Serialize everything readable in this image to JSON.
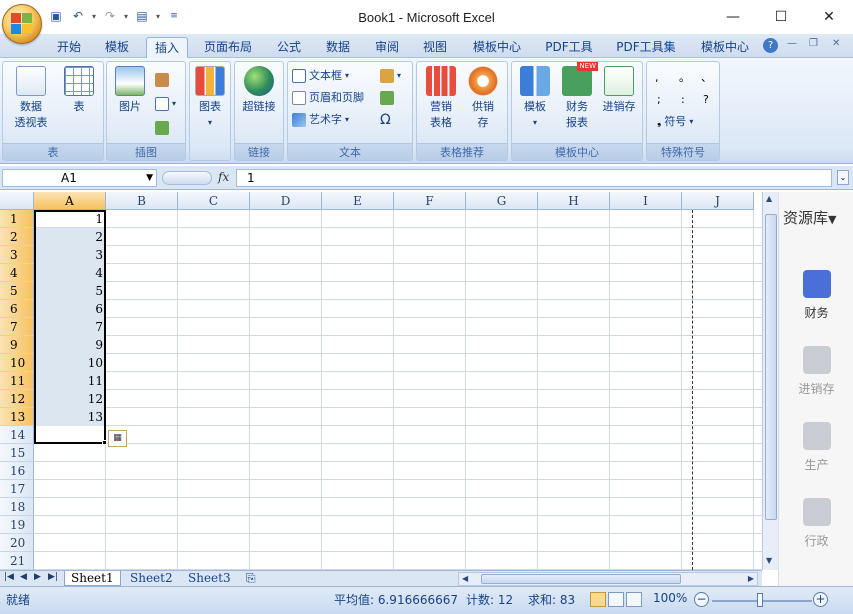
{
  "window": {
    "title": "Book1 - Microsoft Excel",
    "controls": [
      "minimize",
      "maximize",
      "close"
    ]
  },
  "quick_access": [
    "save-icon",
    "undo-icon",
    "redo-icon",
    "print-preview-icon",
    "customize-icon"
  ],
  "tabs": [
    {
      "label": "开始"
    },
    {
      "label": "模板"
    },
    {
      "label": "插入",
      "active": true
    },
    {
      "label": "页面布局"
    },
    {
      "label": "公式"
    },
    {
      "label": "数据"
    },
    {
      "label": "审阅"
    },
    {
      "label": "视图"
    },
    {
      "label": "模板中心"
    },
    {
      "label": "PDF工具"
    },
    {
      "label": "PDF工具集"
    },
    {
      "label": "模板中心"
    }
  ],
  "ribbon": {
    "groups": [
      {
        "label": "表",
        "buttons": [
          "数据\n透视表",
          "表"
        ]
      },
      {
        "label": "插图",
        "buttons": [
          "图片"
        ]
      },
      {
        "label": "",
        "buttons": [
          "图表"
        ]
      },
      {
        "label": "链接",
        "buttons": [
          "超链接"
        ]
      },
      {
        "label": "文本",
        "buttons": [
          "文本框",
          "页眉和页脚",
          "艺术字"
        ]
      },
      {
        "label": "表格推荐",
        "buttons": [
          "营销\n表格",
          "供销\n存"
        ]
      },
      {
        "label": "模板中心",
        "buttons": [
          "模板",
          "财务\n报表",
          "进销存"
        ]
      },
      {
        "label": "特殊符号",
        "buttons": [
          "符号"
        ]
      }
    ],
    "pivot_line1": "数据",
    "pivot_line2": "透视表",
    "table": "表",
    "picture": "图片",
    "chart": "图表",
    "hyperlink": "超链接",
    "textbox": "文本框",
    "header_footer": "页眉和页脚",
    "wordart": "艺术字",
    "omega": "Ω",
    "marketing_1": "营销",
    "marketing_2": "表格",
    "supply_1": "供销",
    "supply_2": "存",
    "template": "模板",
    "finance_1": "财务",
    "finance_2": "报表",
    "inventory": "进销存",
    "new_badge": "NEW",
    "symbol": "符号",
    "sym_chars": [
      ",",
      "。",
      "、",
      ";",
      ":",
      "?"
    ]
  },
  "formula_bar": {
    "name_box": "A1",
    "fx": "fx",
    "value": "1"
  },
  "columns": [
    "A",
    "B",
    "C",
    "D",
    "E",
    "F",
    "G",
    "H",
    "I",
    "J"
  ],
  "rows": [
    {
      "n": "1",
      "a": "1"
    },
    {
      "n": "2",
      "a": "2"
    },
    {
      "n": "3",
      "a": "3"
    },
    {
      "n": "4",
      "a": "4"
    },
    {
      "n": "5",
      "a": "5"
    },
    {
      "n": "6",
      "a": "6"
    },
    {
      "n": "7",
      "a": "7"
    },
    {
      "n": "9",
      "a": "9"
    },
    {
      "n": "10",
      "a": "10"
    },
    {
      "n": "11",
      "a": "11"
    },
    {
      "n": "12",
      "a": "12"
    },
    {
      "n": "13",
      "a": "13"
    },
    {
      "n": "14",
      "a": ""
    },
    {
      "n": "15",
      "a": ""
    },
    {
      "n": "16",
      "a": ""
    },
    {
      "n": "17",
      "a": ""
    },
    {
      "n": "18",
      "a": ""
    },
    {
      "n": "19",
      "a": ""
    },
    {
      "n": "20",
      "a": ""
    },
    {
      "n": "21",
      "a": ""
    }
  ],
  "selected_rows": 12,
  "sheets": [
    {
      "label": "Sheet1",
      "active": true
    },
    {
      "label": "Sheet2"
    },
    {
      "label": "Sheet3"
    }
  ],
  "side_panel": {
    "title": "资源库",
    "items": [
      {
        "label": "财务",
        "icon": "wallet-icon",
        "color": "#4a6fd8"
      },
      {
        "label": "进销存",
        "icon": "swap-icon",
        "color": "#c9ccd2"
      },
      {
        "label": "生产",
        "icon": "import-icon",
        "color": "#c9ccd2"
      },
      {
        "label": "行政",
        "icon": "bank-icon",
        "color": "#c9ccd2"
      }
    ]
  },
  "status": {
    "ready": "就绪",
    "average": "平均值: 6.916666667",
    "count": "计数: 12",
    "sum": "求和: 83",
    "zoom": "100%"
  },
  "colors": {
    "accent": "#15428b",
    "selection_header": "#f6c25f"
  }
}
